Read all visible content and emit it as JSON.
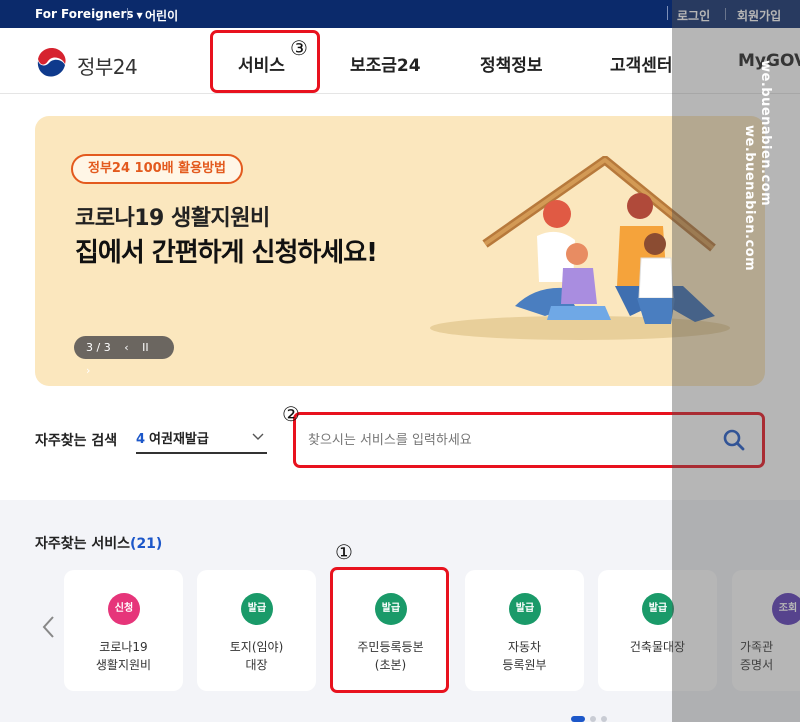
{
  "topbar": {
    "foreigners": "For Foreigners",
    "kids": "어린이",
    "login": "로그인",
    "join": "회원가입"
  },
  "header": {
    "logo_text": "정부24",
    "nav": [
      "서비스",
      "보조금24",
      "정책정보",
      "고객센터",
      "MyGOV"
    ]
  },
  "annotations": {
    "n1": "①",
    "n2": "②",
    "n3": "③"
  },
  "banner": {
    "pill": "정부24 100배 활용방법",
    "line1": "코로나19 생활지원비",
    "line2": "집에서 간편하게 신청하세요!",
    "pager_text": "3 / 3",
    "prev": "‹",
    "pause": "II",
    "next": "›"
  },
  "search": {
    "label": "자주찾는 검색",
    "select_num": "4",
    "select_value": "여권재발급",
    "placeholder": "찾으시는 서비스를 입력하세요"
  },
  "services": {
    "title": "자주찾는 서비스",
    "count": "(21)",
    "cards": [
      {
        "badge": "신청",
        "color": "#e6357a",
        "line1": "코로나19",
        "line2": "생활지원비"
      },
      {
        "badge": "발급",
        "color": "#1a9a69",
        "line1": "토지(임야)",
        "line2": "대장"
      },
      {
        "badge": "발급",
        "color": "#1a9a69",
        "line1": "주민등록등본",
        "line2": "(초본)"
      },
      {
        "badge": "발급",
        "color": "#1a9a69",
        "line1": "자동차",
        "line2": "등록원부"
      },
      {
        "badge": "발급",
        "color": "#1a9a69",
        "line1": "건축물대장",
        "line2": ""
      },
      {
        "badge": "조회",
        "color": "#5b3ab8",
        "line1": "가족관",
        "line2": "증명서"
      }
    ]
  },
  "watermark": {
    "a": "we.buenabien.com",
    "b": "we.buenabien.com"
  },
  "colors": {
    "topbar": "#0b2a6b",
    "accent_blue": "#1c57c9",
    "highlight_red": "#e8121e",
    "banner_bg": "#fbe7be"
  }
}
